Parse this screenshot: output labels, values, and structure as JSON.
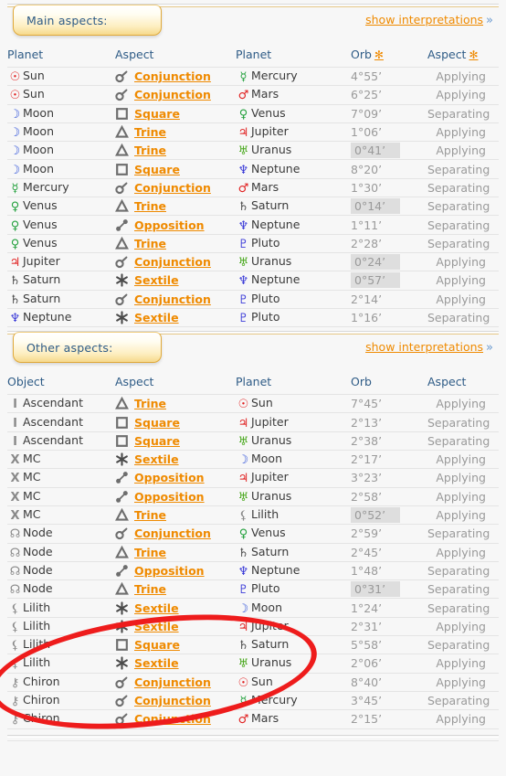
{
  "sections": [
    {
      "tab_label": "Main aspects:",
      "interpretations_link": "show interpretations",
      "chevron": "»",
      "columns": {
        "object": "Planet",
        "aspect": "Aspect",
        "planet": "Planet",
        "orb": "Orb",
        "aspect_kind": "Aspect",
        "orb_star": "✻",
        "kind_star": "✻"
      },
      "show_header_stars": true,
      "rows": [
        {
          "obj_glyph": "☉",
          "obj_class": "g-sun",
          "obj": "Sun",
          "aspect_icon": "conjunction",
          "aspect": "Conjunction",
          "pl_glyph": "☿",
          "pl_class": "g-mercury",
          "planet": "Mercury",
          "orb": "4°55’",
          "orb_highlight": false,
          "kind": "Applying"
        },
        {
          "obj_glyph": "☉",
          "obj_class": "g-sun",
          "obj": "Sun",
          "aspect_icon": "conjunction",
          "aspect": "Conjunction",
          "pl_glyph": "♂",
          "pl_class": "g-mars",
          "planet": "Mars",
          "orb": "6°25’",
          "orb_highlight": false,
          "kind": "Applying"
        },
        {
          "obj_glyph": "☽",
          "obj_class": "g-moon",
          "obj": "Moon",
          "aspect_icon": "square",
          "aspect": "Square",
          "pl_glyph": "♀",
          "pl_class": "g-venus",
          "planet": "Venus",
          "orb": "7°09’",
          "orb_highlight": false,
          "kind": "Separating"
        },
        {
          "obj_glyph": "☽",
          "obj_class": "g-moon",
          "obj": "Moon",
          "aspect_icon": "trine",
          "aspect": "Trine",
          "pl_glyph": "♃",
          "pl_class": "g-jupiter",
          "planet": "Jupiter",
          "orb": "1°06’",
          "orb_highlight": false,
          "kind": "Applying"
        },
        {
          "obj_glyph": "☽",
          "obj_class": "g-moon",
          "obj": "Moon",
          "aspect_icon": "trine",
          "aspect": "Trine",
          "pl_glyph": "♅",
          "pl_class": "g-uranus",
          "planet": "Uranus",
          "orb": "0°41’",
          "orb_highlight": true,
          "kind": "Applying"
        },
        {
          "obj_glyph": "☽",
          "obj_class": "g-moon",
          "obj": "Moon",
          "aspect_icon": "square",
          "aspect": "Square",
          "pl_glyph": "♆",
          "pl_class": "g-neptune",
          "planet": "Neptune",
          "orb": "8°20’",
          "orb_highlight": false,
          "kind": "Separating"
        },
        {
          "obj_glyph": "☿",
          "obj_class": "g-mercury",
          "obj": "Mercury",
          "aspect_icon": "conjunction",
          "aspect": "Conjunction",
          "pl_glyph": "♂",
          "pl_class": "g-mars",
          "planet": "Mars",
          "orb": "1°30’",
          "orb_highlight": false,
          "kind": "Separating"
        },
        {
          "obj_glyph": "♀",
          "obj_class": "g-venus",
          "obj": "Venus",
          "aspect_icon": "trine",
          "aspect": "Trine",
          "pl_glyph": "♄",
          "pl_class": "g-saturn",
          "planet": "Saturn",
          "orb": "0°14’",
          "orb_highlight": true,
          "kind": "Separating"
        },
        {
          "obj_glyph": "♀",
          "obj_class": "g-venus",
          "obj": "Venus",
          "aspect_icon": "opposition",
          "aspect": "Opposition",
          "pl_glyph": "♆",
          "pl_class": "g-neptune",
          "planet": "Neptune",
          "orb": "1°11’",
          "orb_highlight": false,
          "kind": "Separating"
        },
        {
          "obj_glyph": "♀",
          "obj_class": "g-venus",
          "obj": "Venus",
          "aspect_icon": "trine",
          "aspect": "Trine",
          "pl_glyph": "♇",
          "pl_class": "g-pluto",
          "planet": "Pluto",
          "orb": "2°28’",
          "orb_highlight": false,
          "kind": "Separating"
        },
        {
          "obj_glyph": "♃",
          "obj_class": "g-jupiter",
          "obj": "Jupiter",
          "aspect_icon": "conjunction",
          "aspect": "Conjunction",
          "pl_glyph": "♅",
          "pl_class": "g-uranus",
          "planet": "Uranus",
          "orb": "0°24’",
          "orb_highlight": true,
          "kind": "Applying"
        },
        {
          "obj_glyph": "♄",
          "obj_class": "g-saturn",
          "obj": "Saturn",
          "aspect_icon": "sextile",
          "aspect": "Sextile",
          "pl_glyph": "♆",
          "pl_class": "g-neptune",
          "planet": "Neptune",
          "orb": "0°57’",
          "orb_highlight": true,
          "kind": "Applying"
        },
        {
          "obj_glyph": "♄",
          "obj_class": "g-saturn",
          "obj": "Saturn",
          "aspect_icon": "conjunction",
          "aspect": "Conjunction",
          "pl_glyph": "♇",
          "pl_class": "g-pluto",
          "planet": "Pluto",
          "orb": "2°14’",
          "orb_highlight": false,
          "kind": "Applying"
        },
        {
          "obj_glyph": "♆",
          "obj_class": "g-neptune",
          "obj": "Neptune",
          "aspect_icon": "sextile",
          "aspect": "Sextile",
          "pl_glyph": "♇",
          "pl_class": "g-pluto",
          "planet": "Pluto",
          "orb": "1°16’",
          "orb_highlight": false,
          "kind": "Separating"
        }
      ]
    },
    {
      "tab_label": "Other aspects:",
      "interpretations_link": "show interpretations",
      "chevron": "»",
      "columns": {
        "object": "Object",
        "aspect": "Aspect",
        "planet": "Planet",
        "orb": "Orb",
        "aspect_kind": "Aspect",
        "orb_star": "",
        "kind_star": ""
      },
      "show_header_stars": false,
      "rows": [
        {
          "obj_glyph": "I",
          "obj_class": "g-grey",
          "obj": "Ascendant",
          "aspect_icon": "trine",
          "aspect": "Trine",
          "pl_glyph": "☉",
          "pl_class": "g-sun",
          "planet": "Sun",
          "orb": "7°45’",
          "orb_highlight": false,
          "kind": "Applying"
        },
        {
          "obj_glyph": "I",
          "obj_class": "g-grey",
          "obj": "Ascendant",
          "aspect_icon": "square",
          "aspect": "Square",
          "pl_glyph": "♃",
          "pl_class": "g-jupiter",
          "planet": "Jupiter",
          "orb": "2°13’",
          "orb_highlight": false,
          "kind": "Separating"
        },
        {
          "obj_glyph": "I",
          "obj_class": "g-grey",
          "obj": "Ascendant",
          "aspect_icon": "square",
          "aspect": "Square",
          "pl_glyph": "♅",
          "pl_class": "g-uranus",
          "planet": "Uranus",
          "orb": "2°38’",
          "orb_highlight": false,
          "kind": "Separating"
        },
        {
          "obj_glyph": "X",
          "obj_class": "g-grey",
          "obj": "MC",
          "aspect_icon": "sextile",
          "aspect": "Sextile",
          "pl_glyph": "☽",
          "pl_class": "g-moon",
          "planet": "Moon",
          "orb": "2°17’",
          "orb_highlight": false,
          "kind": "Applying"
        },
        {
          "obj_glyph": "X",
          "obj_class": "g-grey",
          "obj": "MC",
          "aspect_icon": "opposition",
          "aspect": "Opposition",
          "pl_glyph": "♃",
          "pl_class": "g-jupiter",
          "planet": "Jupiter",
          "orb": "3°23’",
          "orb_highlight": false,
          "kind": "Applying"
        },
        {
          "obj_glyph": "X",
          "obj_class": "g-grey",
          "obj": "MC",
          "aspect_icon": "opposition",
          "aspect": "Opposition",
          "pl_glyph": "♅",
          "pl_class": "g-uranus",
          "planet": "Uranus",
          "orb": "2°58’",
          "orb_highlight": false,
          "kind": "Applying"
        },
        {
          "obj_glyph": "X",
          "obj_class": "g-grey",
          "obj": "MC",
          "aspect_icon": "trine",
          "aspect": "Trine",
          "pl_glyph": "⚸",
          "pl_class": "g-grey",
          "planet": "Lilith",
          "orb": "0°52’",
          "orb_highlight": true,
          "kind": "Applying"
        },
        {
          "obj_glyph": "☊",
          "obj_class": "g-grey",
          "obj": "Node",
          "aspect_icon": "conjunction",
          "aspect": "Conjunction",
          "pl_glyph": "♀",
          "pl_class": "g-venus",
          "planet": "Venus",
          "orb": "2°59’",
          "orb_highlight": false,
          "kind": "Separating"
        },
        {
          "obj_glyph": "☊",
          "obj_class": "g-grey",
          "obj": "Node",
          "aspect_icon": "trine",
          "aspect": "Trine",
          "pl_glyph": "♄",
          "pl_class": "g-saturn",
          "planet": "Saturn",
          "orb": "2°45’",
          "orb_highlight": false,
          "kind": "Applying"
        },
        {
          "obj_glyph": "☊",
          "obj_class": "g-grey",
          "obj": "Node",
          "aspect_icon": "opposition",
          "aspect": "Opposition",
          "pl_glyph": "♆",
          "pl_class": "g-neptune",
          "planet": "Neptune",
          "orb": "1°48’",
          "orb_highlight": false,
          "kind": "Separating"
        },
        {
          "obj_glyph": "☊",
          "obj_class": "g-grey",
          "obj": "Node",
          "aspect_icon": "trine",
          "aspect": "Trine",
          "pl_glyph": "♇",
          "pl_class": "g-pluto",
          "planet": "Pluto",
          "orb": "0°31’",
          "orb_highlight": true,
          "kind": "Separating"
        },
        {
          "obj_glyph": "⚸",
          "obj_class": "g-grey",
          "obj": "Lilith",
          "aspect_icon": "sextile",
          "aspect": "Sextile",
          "pl_glyph": "☽",
          "pl_class": "g-moon",
          "planet": "Moon",
          "orb": "1°24’",
          "orb_highlight": false,
          "kind": "Separating"
        },
        {
          "obj_glyph": "⚸",
          "obj_class": "g-grey",
          "obj": "Lilith",
          "aspect_icon": "sextile",
          "aspect": "Sextile",
          "pl_glyph": "♃",
          "pl_class": "g-jupiter",
          "planet": "Jupiter",
          "orb": "2°31’",
          "orb_highlight": false,
          "kind": "Applying"
        },
        {
          "obj_glyph": "⚸",
          "obj_class": "g-grey",
          "obj": "Lilith",
          "aspect_icon": "square",
          "aspect": "Square",
          "pl_glyph": "♄",
          "pl_class": "g-saturn",
          "planet": "Saturn",
          "orb": "5°58’",
          "orb_highlight": false,
          "kind": "Separating"
        },
        {
          "obj_glyph": "⚸",
          "obj_class": "g-grey",
          "obj": "Lilith",
          "aspect_icon": "sextile",
          "aspect": "Sextile",
          "pl_glyph": "♅",
          "pl_class": "g-uranus",
          "planet": "Uranus",
          "orb": "2°06’",
          "orb_highlight": false,
          "kind": "Applying"
        },
        {
          "obj_glyph": "⚷",
          "obj_class": "g-grey",
          "obj": "Chiron",
          "aspect_icon": "conjunction",
          "aspect": "Conjunction",
          "pl_glyph": "☉",
          "pl_class": "g-sun",
          "planet": "Sun",
          "orb": "8°40’",
          "orb_highlight": false,
          "kind": "Applying"
        },
        {
          "obj_glyph": "⚷",
          "obj_class": "g-grey",
          "obj": "Chiron",
          "aspect_icon": "conjunction",
          "aspect": "Conjunction",
          "pl_glyph": "☿",
          "pl_class": "g-mercury",
          "planet": "Mercury",
          "orb": "3°45’",
          "orb_highlight": false,
          "kind": "Separating"
        },
        {
          "obj_glyph": "⚷",
          "obj_class": "g-grey",
          "obj": "Chiron",
          "aspect_icon": "conjunction",
          "aspect": "Conjunction",
          "pl_glyph": "♂",
          "pl_class": "g-mars",
          "planet": "Mars",
          "orb": "2°15’",
          "orb_highlight": false,
          "kind": "Applying"
        }
      ]
    }
  ],
  "annotation": {
    "shape": "ellipse",
    "color": "#ee1c1c",
    "highlights_rows": "Lilith aspect rows"
  }
}
